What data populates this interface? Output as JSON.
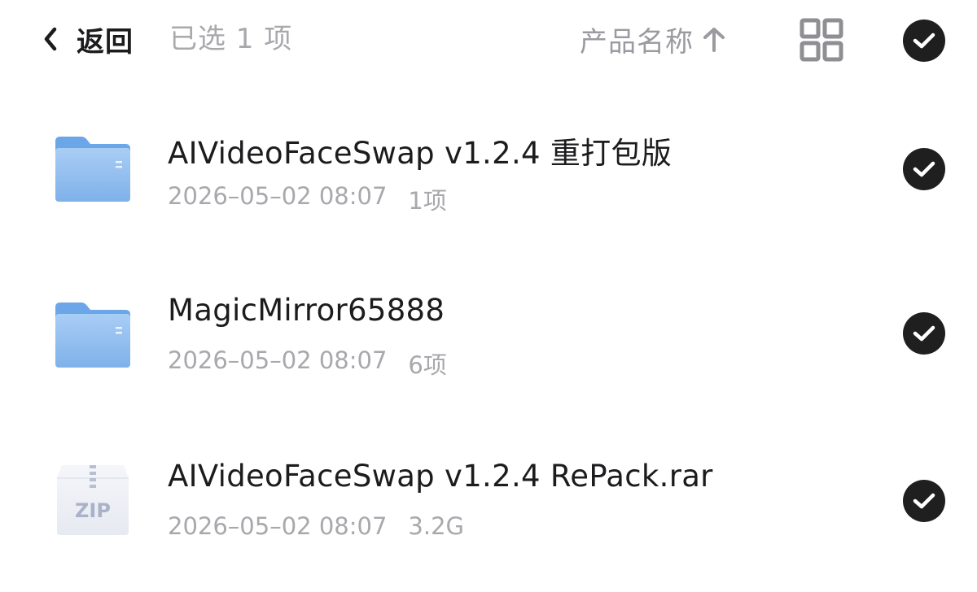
{
  "header": {
    "back_label": "返回",
    "selected_count": "已选 1 项",
    "sort_label": "产品名称",
    "back_icon": "chevron-left-icon",
    "sort_icon": "arrow-up-icon",
    "view_icon": "grid-view-icon",
    "select_all_icon": "check-circle-icon",
    "select_all_checked": true
  },
  "files": [
    {
      "name": "AIVideoFaceSwap v1.2.4 重打包版",
      "date": "2026–05–02 08:07",
      "size": "1项",
      "type": "folder",
      "icon": "folder-icon",
      "selected": true
    },
    {
      "name": "MagicMirror65888",
      "date": "2026–05–02 08:07",
      "size": "6项",
      "type": "folder",
      "icon": "folder-icon",
      "selected": true
    },
    {
      "name": "AIVideoFaceSwap v1.2.4 RePack.rar",
      "date": "2026–05–02 08:07",
      "size": "3.2G",
      "type": "zip",
      "icon": "zip-file-icon",
      "icon_label": "ZIP",
      "selected": true
    }
  ],
  "colors": {
    "folder": "#8ab9ee",
    "check_bg": "#1f1f1f",
    "muted_text": "#a8a8ad",
    "primary_text": "#1c1c1e"
  }
}
